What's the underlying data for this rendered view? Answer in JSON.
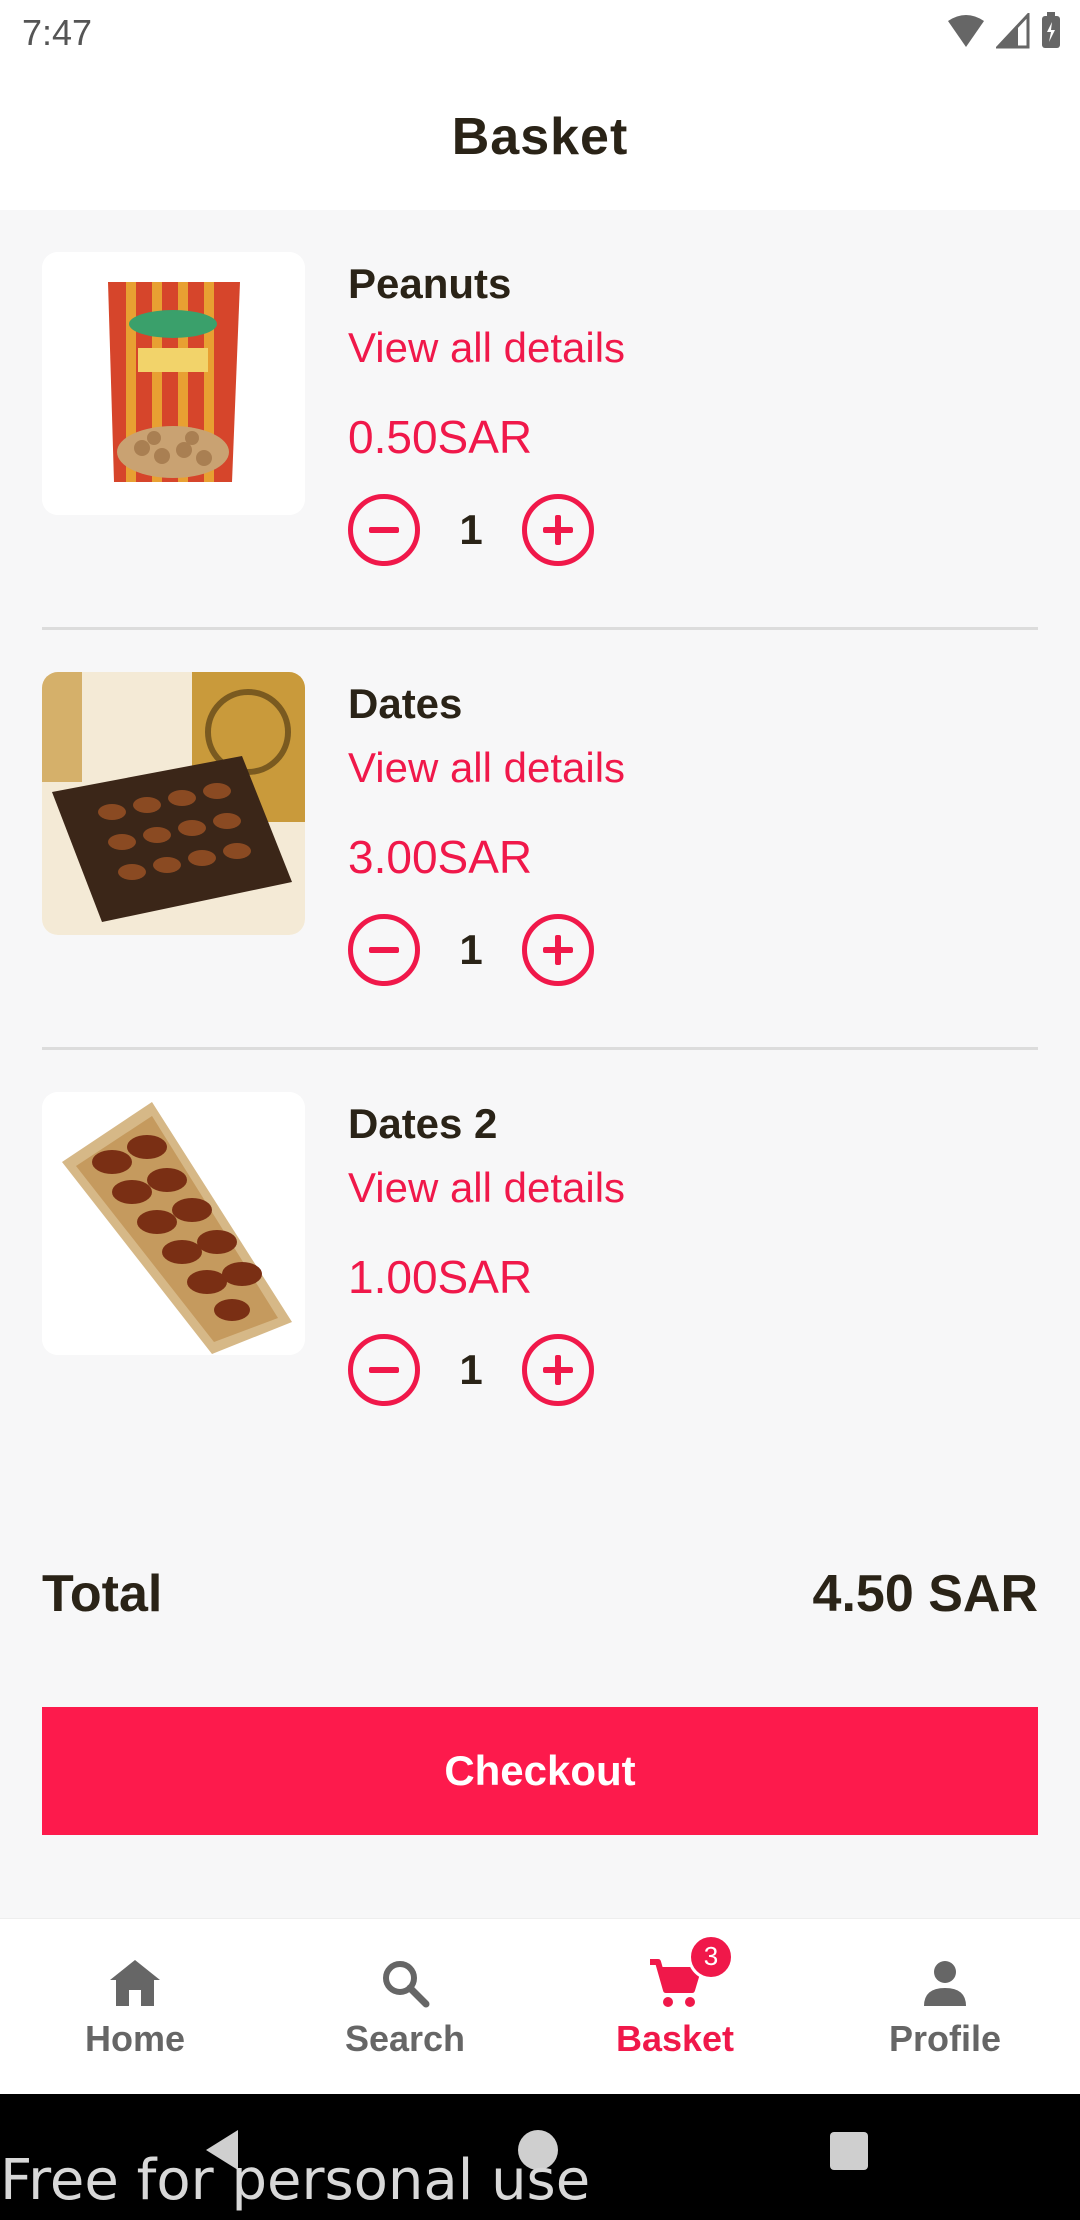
{
  "status_bar": {
    "time": "7:47"
  },
  "header": {
    "title": "Basket"
  },
  "items": [
    {
      "name": "Peanuts",
      "link": "View all details",
      "price": "0.50SAR",
      "qty": "1"
    },
    {
      "name": "Dates",
      "link": "View all details",
      "price": "3.00SAR",
      "qty": "1"
    },
    {
      "name": "Dates 2",
      "link": "View all details",
      "price": "1.00SAR",
      "qty": "1"
    }
  ],
  "summary": {
    "total_label": "Total",
    "total_value": "4.50 SAR"
  },
  "checkout": {
    "label": "Checkout"
  },
  "nav": {
    "items": [
      {
        "label": "Home",
        "icon": "home-icon"
      },
      {
        "label": "Search",
        "icon": "search-icon"
      },
      {
        "label": "Basket",
        "icon": "cart-icon",
        "badge": "3"
      },
      {
        "label": "Profile",
        "icon": "person-icon"
      }
    ],
    "active": "Basket"
  },
  "watermark": "Free for personal use",
  "colors": {
    "accent": "#f0184a",
    "checkout": "#fd1a4c",
    "text": "#2a2317",
    "background": "#f7f7f8"
  }
}
